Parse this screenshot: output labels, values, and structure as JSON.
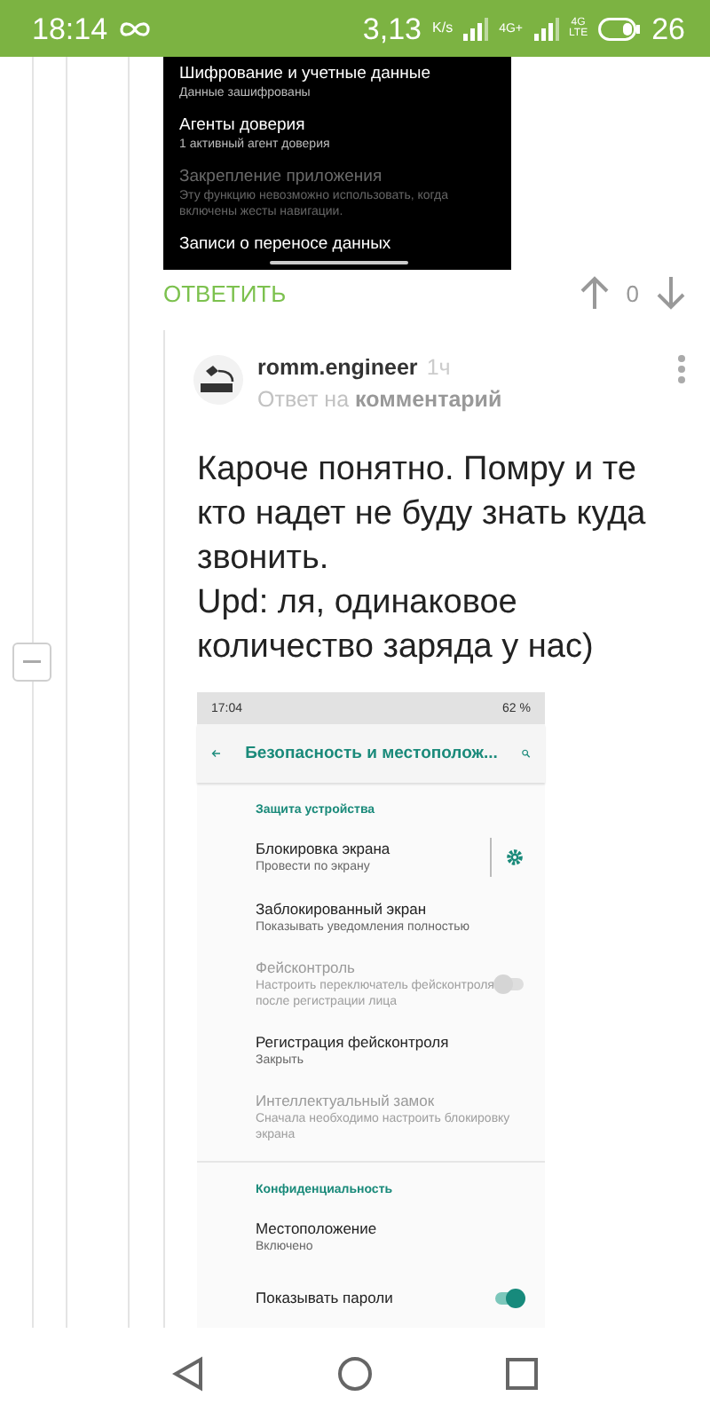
{
  "status_bar": {
    "time": "18:14",
    "speed": "3,13",
    "speed_unit": "K/s",
    "network_1": "4G+",
    "network_2": "4G",
    "network_2_sub": "LTE",
    "battery": "26"
  },
  "top_screenshot": {
    "items": [
      {
        "title": "Шифрование и учетные данные",
        "subtitle": "Данные зашифрованы",
        "disabled": false
      },
      {
        "title": "Агенты доверия",
        "subtitle": "1 активный агент доверия",
        "disabled": false
      },
      {
        "title": "Закрепление приложения",
        "subtitle": "Эту функцию невозможно использовать, когда включены жесты навигации.",
        "disabled": true
      },
      {
        "title": "Записи о переносе данных",
        "disabled": false
      }
    ]
  },
  "reply_bar": {
    "reply": "ОТВЕТИТЬ",
    "score": "0"
  },
  "comment": {
    "author": "romm.engineer",
    "time": "1ч",
    "reply_to": "Ответ на **комментарий**",
    "paragraphs": [
      "Кароче понятно. Помру и те кто надет не буду знать куда звонить.",
      "Upd: ля, одинаковое количество заряда у нас)"
    ]
  },
  "comment_screenshot": {
    "status": {
      "time": "17:04",
      "battery": "62 %"
    },
    "title": "Безопасность и местополож...",
    "sections": [
      {
        "header": "Защита устройства",
        "items": [
          {
            "kind": "gear",
            "title": "Блокировка экрана",
            "subtitle": "Провести по экрану",
            "disabled": false
          },
          {
            "kind": "plain",
            "title": "Заблокированный экран",
            "subtitle": "Показывать уведомления полностью",
            "disabled": false
          },
          {
            "kind": "toggle",
            "title": "Фейсконтроль",
            "subtitle": "Настроить переключатель фейсконтроля после регистрации лица",
            "disabled": true,
            "on": false
          },
          {
            "kind": "plain",
            "title": "Регистрация фейсконтроля",
            "subtitle": "Закрыть",
            "disabled": false
          },
          {
            "kind": "plain",
            "title": "Интеллектуальный замок",
            "subtitle": "Сначала необходимо настроить блокировку экрана",
            "disabled": true
          }
        ]
      },
      {
        "header": "Конфиденциальность",
        "items": [
          {
            "kind": "plain",
            "title": "Местоположение",
            "subtitle": "Включено",
            "disabled": false
          },
          {
            "kind": "toggle",
            "title": "Показывать пароли",
            "disabled": false,
            "on": true
          }
        ]
      }
    ]
  }
}
